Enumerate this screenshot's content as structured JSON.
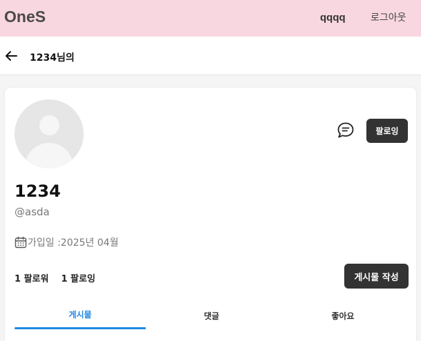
{
  "header": {
    "logo": "OneS",
    "username": "qqqq",
    "logout": "로그아웃"
  },
  "subheader": {
    "title": "1234님의"
  },
  "profile": {
    "name": "1234",
    "handle": "@asda",
    "joined": "가입일 :2025년 04월",
    "follow_button": "팔로잉",
    "followers": "1 팔로워",
    "following": "1 팔로잉",
    "write_button": "게시물 작성"
  },
  "tabs": [
    {
      "label": "게시물",
      "active": true
    },
    {
      "label": "댓글",
      "active": false
    },
    {
      "label": "좋아요",
      "active": false
    }
  ],
  "colors": {
    "header_bg": "#f8d7e1",
    "accent": "#1e88e5",
    "button_dark": "#333333"
  }
}
